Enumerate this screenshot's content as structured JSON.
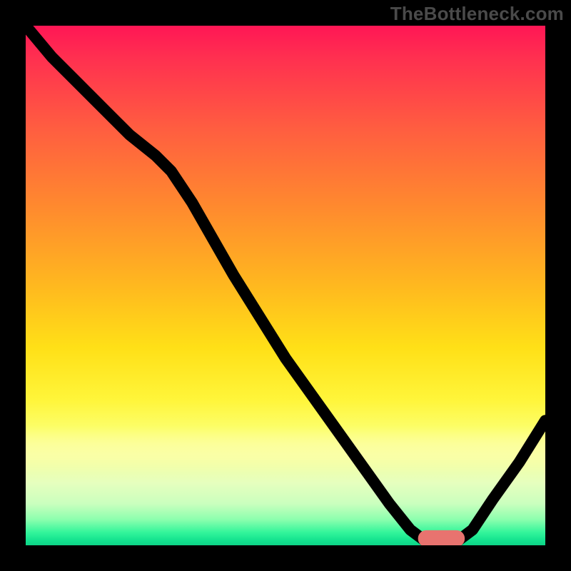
{
  "watermark": "TheBottleneck.com",
  "chart_data": {
    "type": "line",
    "title": "",
    "xlabel": "",
    "ylabel": "",
    "xlim": [
      0,
      100
    ],
    "ylim": [
      0,
      100
    ],
    "grid": false,
    "legend": false,
    "background": {
      "kind": "vertical-gradient",
      "meaning": "red=high bottleneck, green=low bottleneck",
      "stops": [
        {
          "pos": 0.0,
          "color": "#ff1655"
        },
        {
          "pos": 0.2,
          "color": "#ff5e40"
        },
        {
          "pos": 0.5,
          "color": "#ffb81f"
        },
        {
          "pos": 0.72,
          "color": "#fff53a"
        },
        {
          "pos": 0.88,
          "color": "#e6ffbe"
        },
        {
          "pos": 1.0,
          "color": "#0ed487"
        }
      ]
    },
    "series": [
      {
        "name": "bottleneck-curve",
        "color": "#000000",
        "x": [
          0,
          5,
          10,
          15,
          20,
          25,
          28,
          32,
          36,
          40,
          45,
          50,
          55,
          60,
          65,
          70,
          74,
          78,
          82,
          86,
          90,
          95,
          100
        ],
        "y": [
          100,
          94,
          89,
          84,
          79,
          75,
          72,
          66,
          59,
          52,
          44,
          36,
          29,
          22,
          15,
          8,
          3,
          0,
          0,
          3,
          9,
          16,
          24
        ]
      }
    ],
    "annotations": [
      {
        "name": "optimal-marker",
        "shape": "rounded-bar",
        "color": "#e8736f",
        "x_range": [
          76,
          84
        ],
        "y": 0
      }
    ]
  }
}
